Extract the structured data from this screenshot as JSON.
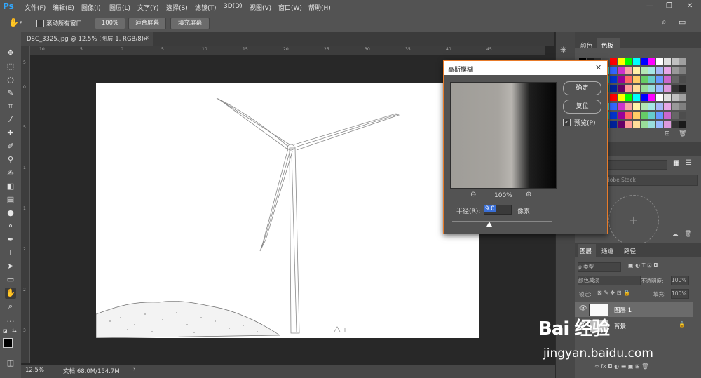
{
  "app": {
    "logo": "Ps"
  },
  "menu": [
    "文件(F)",
    "编辑(E)",
    "图像(I)",
    "图层(L)",
    "文字(Y)",
    "选择(S)",
    "滤镜(T)",
    "3D(D)",
    "视图(V)",
    "窗口(W)",
    "帮助(H)"
  ],
  "window_controls": {
    "minimize": "—",
    "restore": "❐",
    "close": "✕"
  },
  "options": {
    "scroll_all_label": "滚动所有窗口",
    "zoom_100": "100%",
    "fit_screen": "适合屏幕",
    "fill_screen": "填充屏幕"
  },
  "document_tab": {
    "title": "DSC_3325.jpg @ 12.5% (图层 1, RGB/8) *",
    "close": "×"
  },
  "ruler_h": [
    "10",
    "5",
    "0",
    "5",
    "10",
    "15",
    "20",
    "25",
    "30",
    "35",
    "40",
    "45"
  ],
  "ruler_v": [
    "5",
    "0",
    "5",
    "1",
    "1",
    "2",
    "2",
    "3"
  ],
  "status": {
    "zoom": "12.5%",
    "doc": "文档:68.0M/154.7M",
    "arrow": "›"
  },
  "swatch_panel": {
    "tab_color": "颜色",
    "tab_swatches": "色板"
  },
  "library": {
    "search_placeholder": "dobe Stock",
    "plus": "+"
  },
  "layers_panel": {
    "tabs": [
      "图层",
      "通道",
      "路径"
    ],
    "kind_label": "ρ 类型",
    "blend_mode": "颜色减淡",
    "opacity_label": "不透明度:",
    "opacity_value": "100%",
    "lock_label": "锁定:",
    "fill_label": "填充:",
    "fill_value": "100%",
    "layers": [
      {
        "name": "图层 1"
      },
      {
        "name": "背景"
      }
    ],
    "bottom_icons": "∞  fx  ◘  ◐  ▬  ▣  ⊞  🗑"
  },
  "dialog": {
    "title": "高斯模糊",
    "close": "✕",
    "ok": "确定",
    "reset": "复位",
    "preview_label": "预览(P)",
    "zoom_value": "100%",
    "zoom_out": "⊖",
    "zoom_in": "⊕",
    "radius_label": "半径(R):",
    "radius_value": "9.0",
    "unit": "像素"
  },
  "watermark": {
    "brand": "Bai 经验",
    "url": "jingyan.baidu.com"
  },
  "colors": {
    "accent": "#31a8ff",
    "dialog_border": "#e87b2a",
    "bg": "#282828",
    "panel": "#535353"
  }
}
